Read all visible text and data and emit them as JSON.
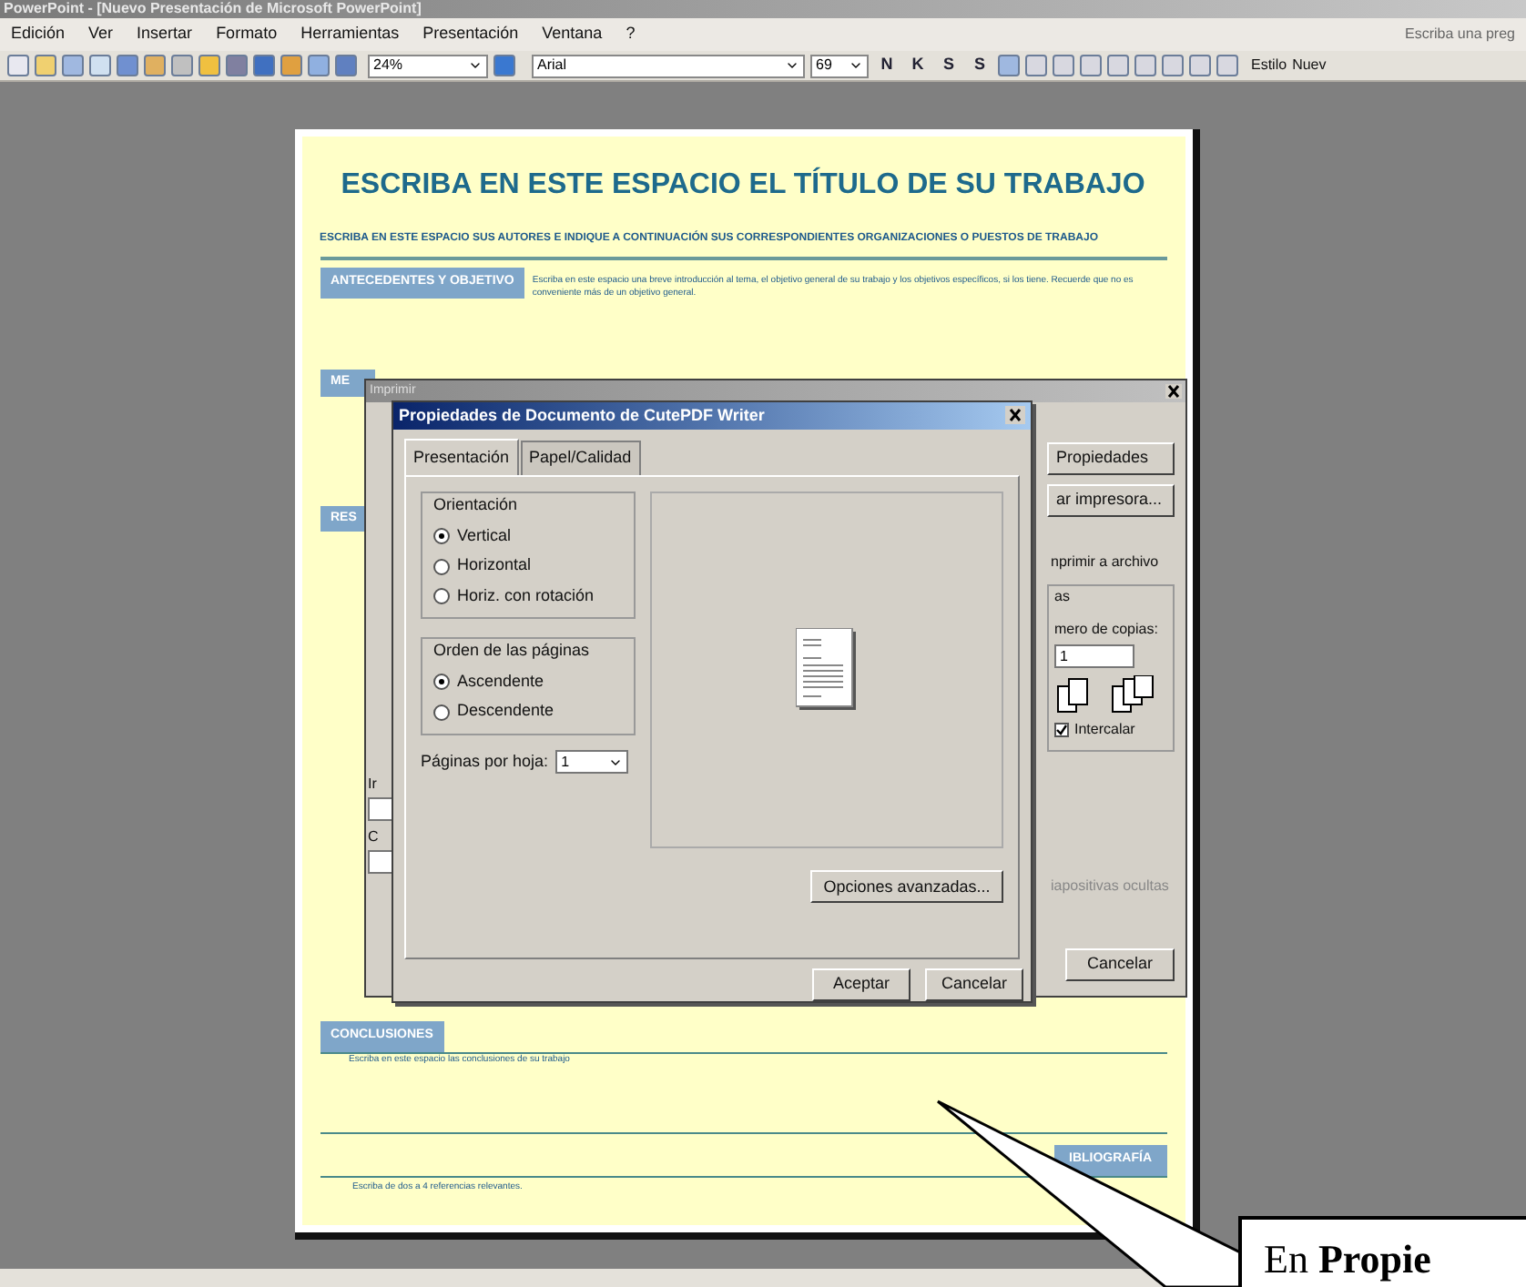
{
  "window": {
    "title": "PowerPoint - [Nuevo Presentación de Microsoft PowerPoint]"
  },
  "menu": [
    "Edición",
    "Ver",
    "Insertar",
    "Formato",
    "Herramientas",
    "Presentación",
    "Ventana",
    "?"
  ],
  "help_box": {
    "placeholder": "Escriba una preg"
  },
  "toolbar": {
    "zoom": "24%",
    "font": "Arial",
    "size": "69",
    "format_buttons": [
      "N",
      "K",
      "S",
      "S"
    ],
    "style_button": "Estilo",
    "new_button": "Nuev"
  },
  "slide": {
    "title": "ESCRIBA EN ESTE ESPACIO EL TÍTULO DE SU TRABAJO",
    "authors": "ESCRIBA EN ESTE ESPACIO SUS AUTORES E INDIQUE A CONTINUACIÓN SUS CORRESPONDIENTES ORGANIZACIONES O PUESTOS DE TRABAJO",
    "intro_header": "ANTECEDENTES Y OBJETIVO",
    "intro_text": "Escriba en este espacio una breve introducción al tema, el objetivo general de su trabajo y los objetivos específicos, si los tiene. Recuerde que no es conveniente más de un objetivo general.",
    "hidden_headers": [
      "ME",
      "RES"
    ],
    "conclusions_header": "CONCLUSIONES",
    "conclusions_text": "Escriba en este espacio las conclusiones de su trabajo",
    "bibliography_header": "IBLIOGRAFÍA",
    "bibliography_text": "Escriba de dos a 4 referencias relevantes."
  },
  "print_dialog": {
    "title": "Imprimir",
    "buttons": [
      "Propiedades",
      "ar impresora..."
    ],
    "print_to_file": "nprimir a archivo",
    "copies_group": "as",
    "copies_label": "mero de copias:",
    "copies_value": "1",
    "collate": {
      "label": "Intercalar",
      "checked": true
    },
    "hidden_slides": "iapositivas ocultas",
    "left_labels": [
      "Ir",
      "C"
    ],
    "cancel": "Cancelar"
  },
  "properties_dialog": {
    "title": "Propiedades de Documento de CutePDF Writer",
    "tabs": [
      {
        "label": "Presentación",
        "selected": true
      },
      {
        "label": "Papel/Calidad",
        "selected": false
      }
    ],
    "orientation": {
      "label": "Orientación",
      "options": [
        {
          "label": "Vertical",
          "selected": true
        },
        {
          "label": "Horizontal",
          "selected": false
        },
        {
          "label": "Horiz. con rotación",
          "selected": false
        }
      ]
    },
    "page_order": {
      "label": "Orden de las páginas",
      "options": [
        {
          "label": "Ascendente",
          "selected": true
        },
        {
          "label": "Descendente",
          "selected": false
        }
      ]
    },
    "pages_per_sheet": {
      "label": "Páginas por hoja:",
      "value": "1"
    },
    "advanced_button": "Opciones avanzadas...",
    "buttons": [
      "Aceptar",
      "Cancelar"
    ]
  },
  "callout": {
    "text": "En **Propie**"
  }
}
